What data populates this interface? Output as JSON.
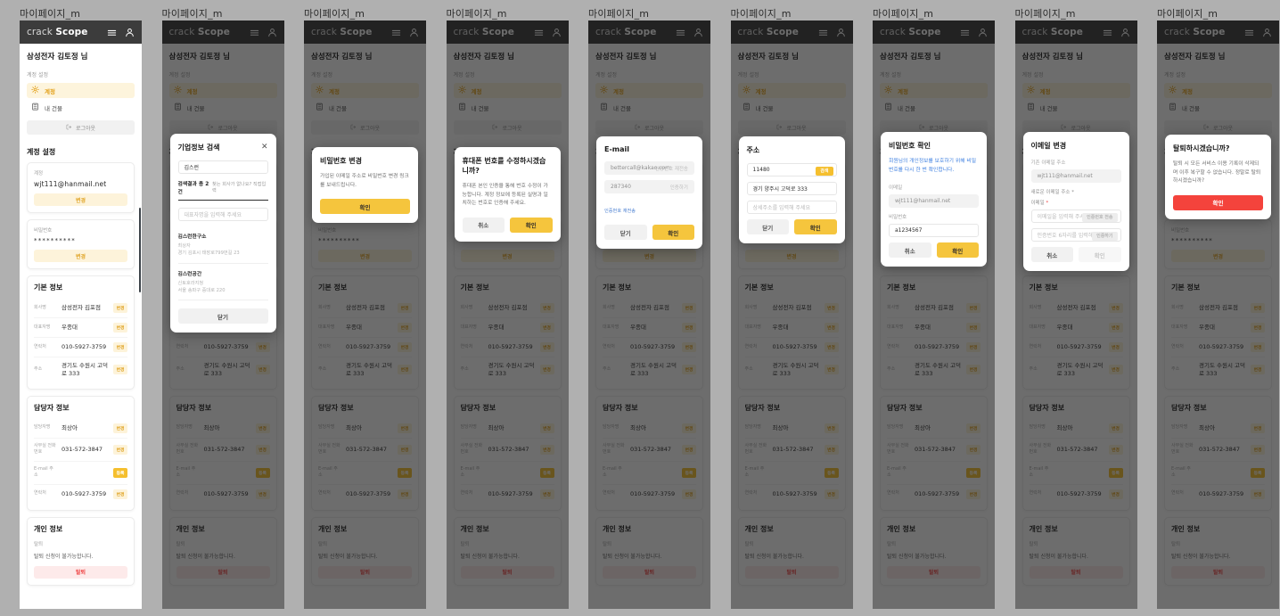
{
  "frame_label": "마이페이지_m",
  "app": {
    "logo_part1": "crack",
    "logo_part2": "Scope",
    "menu_icon": "hamburger-icon",
    "user_icon": "person-icon"
  },
  "page": {
    "user_name": "삼성전자 김토정 님",
    "nav_section_label": "계정 설정",
    "nav_items": [
      {
        "label": "계정",
        "icon": "gear-icon",
        "active": true
      },
      {
        "label": "내 건물",
        "icon": "building-icon",
        "active": false
      }
    ],
    "logout_label": "로그아웃",
    "account_settings_title": "계정 설정",
    "account_card": {
      "email_label": "계정",
      "email_value": "wjt111@hanmail.net",
      "email_change_btn": "변경",
      "password_label": "비밀번호",
      "password_value": "**********",
      "password_change_btn": "변경"
    },
    "basic_info": {
      "title": "기본 정보",
      "rows": [
        {
          "key": "회사명",
          "value": "삼성전자 김포점",
          "btn": "변경",
          "solid": false
        },
        {
          "key": "대표자명",
          "value": "우종대",
          "btn": "변경",
          "solid": false
        },
        {
          "key": "연락처",
          "value": "010-5927-3759",
          "btn": "변경",
          "solid": false
        },
        {
          "key": "주소",
          "value": "경기도 수원시 고덕로 333",
          "btn": "변경",
          "solid": false
        }
      ]
    },
    "manager_info": {
      "title": "담당자 정보",
      "rows": [
        {
          "key": "담당자명",
          "value": "최상아",
          "btn": "변경",
          "solid": false
        },
        {
          "key": "사무실 전화번호",
          "value": "031-572-3847",
          "btn": "변경",
          "solid": false
        },
        {
          "key": "E-mail 주소",
          "value": "",
          "btn": "등록",
          "solid": true
        },
        {
          "key": "연락처",
          "value": "010-5927-3759",
          "btn": "변경",
          "solid": false
        }
      ]
    },
    "personal_info": {
      "title": "개인 정보",
      "note": "탈퇴",
      "desc": "탈퇴 신청이 불가능합니다.",
      "btn": "탈퇴"
    }
  },
  "modals": {
    "company_search": {
      "title": "기업정보 검색",
      "close_icon": "close-icon",
      "query_value": "김스런",
      "results_count_label": "검색결과 총 2건",
      "manual_link": "찾는 회사가 없나요? 직접입력",
      "rep_placeholder": "대표자명을 입력해 주세요",
      "results": [
        {
          "name": "김스런한구소",
          "rep": "최상자",
          "addr": "경기 김포시 태장로799번길 23"
        },
        {
          "name": "김스런공간",
          "rep": "신토호라지청",
          "addr": "서울 송파구 중대로 220"
        }
      ],
      "close_btn": "닫기"
    },
    "password_change": {
      "title": "비밀번호 변경",
      "text": "가입된 이메일 주소로 비밀번호 변경 링크를 보내드립니다.",
      "confirm_btn": "확인"
    },
    "phone_edit": {
      "title": "휴대폰 번호를 수정하시겠습니까?",
      "text": "휴대폰 본인 인증을 통해 번호 수정이 가능합니다. 계정 정보에 등록된 실명과 일치하는 번호로 인증해 주세요.",
      "cancel_btn": "취소",
      "confirm_btn": "확인"
    },
    "email_verify": {
      "title": "E-mail",
      "email_value": "bettercall@kakao.com",
      "email_right": "인증번호 재전송",
      "code_value": "287340",
      "code_right": "인증하기",
      "timer_link": "인증번호 재전송",
      "close_btn": "닫기",
      "confirm_btn": "확인"
    },
    "address": {
      "title": "주소",
      "zip_value": "11480",
      "zip_btn": "검색",
      "addr_value": "경기 양주시 고덕로 333",
      "detail_placeholder": "상세주소를 입력해 주세요",
      "close_btn": "닫기",
      "confirm_btn": "확인"
    },
    "password_confirm": {
      "title": "비밀번호 확인",
      "text": "회원님의 개인정보를 보호하기 위해 비밀번호를 다시 한 번 확인합니다.",
      "email_label": "이메일",
      "email_value": "wjt111@hanmail.net",
      "password_label": "비밀번호",
      "password_value": "a1234567",
      "cancel_btn": "취소",
      "confirm_btn": "확인"
    },
    "email_change": {
      "title": "이메일 변경",
      "current_label": "기존 이메일 주소",
      "current_value": "wjt111@hanmail.net",
      "new_label": "새로운 이메일 주소 *",
      "field_label": "이메일",
      "field_required": "*",
      "email_placeholder": "이메일을 입력해 주세요",
      "email_action": "인증번호 전송",
      "code_placeholder": "인증번호 6자리를 입력해 주세요",
      "code_action": "인증하기",
      "cancel_btn": "취소",
      "confirm_btn": "확인"
    },
    "withdraw": {
      "title": "탈퇴하시겠습니까?",
      "text": "탈퇴 시 모든 서비스 이용 기록이 삭제되며 이후 복구할 수 없습니다. 정말로 탈퇴하시겠습니까?",
      "confirm_btn": "확인"
    }
  }
}
